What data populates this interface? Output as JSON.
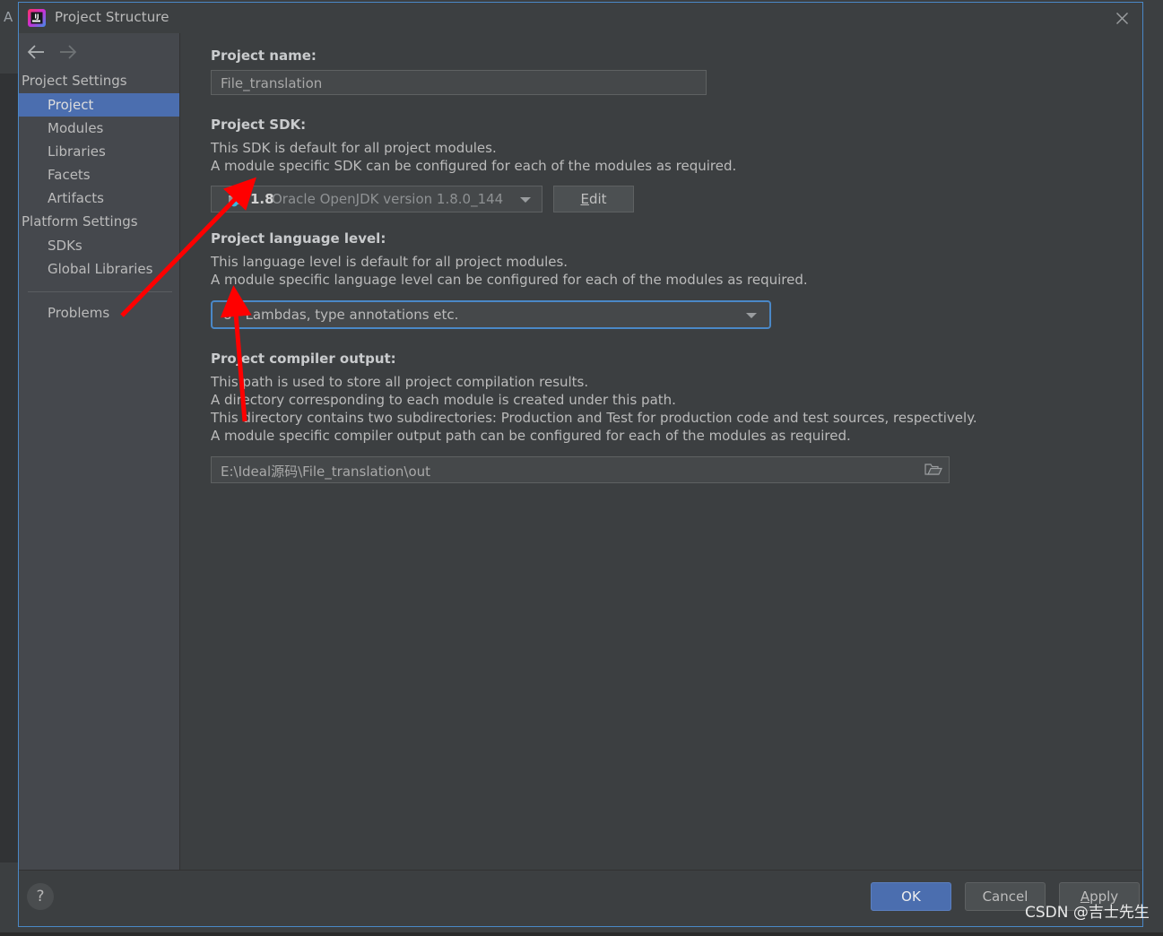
{
  "backdrop": {
    "letter": "A"
  },
  "window": {
    "title": "Project Structure",
    "icon": "intellij-idea-icon",
    "close_label": "close-icon"
  },
  "sidebar": {
    "nav": {
      "back": "back-arrow-icon",
      "forward": "forward-arrow-icon"
    },
    "groups": [
      {
        "title": "Project Settings",
        "items": [
          {
            "label": "Project",
            "selected": true
          },
          {
            "label": "Modules",
            "selected": false
          },
          {
            "label": "Libraries",
            "selected": false
          },
          {
            "label": "Facets",
            "selected": false
          },
          {
            "label": "Artifacts",
            "selected": false
          }
        ]
      },
      {
        "title": "Platform Settings",
        "items": [
          {
            "label": "SDKs",
            "selected": false
          },
          {
            "label": "Global Libraries",
            "selected": false
          }
        ]
      }
    ],
    "extra_items": [
      {
        "label": "Problems",
        "selected": false
      }
    ]
  },
  "main": {
    "project_name": {
      "label": "Project name:",
      "value": "File_translation",
      "placeholder": ""
    },
    "project_sdk": {
      "label": "Project SDK:",
      "desc_lines": [
        "This SDK is default for all project modules.",
        "A module specific SDK can be configured for each of the modules as required."
      ],
      "selected_version": "1.8",
      "selected_desc": "Oracle OpenJDK version 1.8.0_144",
      "icon": "jdk-folder-icon",
      "edit_button": {
        "mnemonic": "E",
        "rest": "dit"
      }
    },
    "language_level": {
      "label": "Project language level:",
      "desc_lines": [
        "This language level is default for all project modules.",
        "A module specific language level can be configured for each of the modules as required."
      ],
      "selected": "8 - Lambdas, type annotations etc.",
      "focus_color": "#4a88c7"
    },
    "compiler_output": {
      "label": "Project compiler output:",
      "desc_lines": [
        "This path is used to store all project compilation results.",
        "A directory corresponding to each module is created under this path.",
        "This directory contains two subdirectories: Production and Test for production code and test sources, respectively.",
        "A module specific compiler output path can be configured for each of the modules as required."
      ],
      "value": "E:\\Ideal源码\\File_translation\\out",
      "browse_icon": "folder-browse-icon"
    }
  },
  "footer": {
    "help": "?",
    "ok": "OK",
    "cancel": "Cancel",
    "apply_mnemonic": "A",
    "apply_rest": "pply"
  },
  "annotations": {
    "arrow_color": "#ff0000",
    "watermark": "CSDN @吉士先生"
  },
  "colors": {
    "dialog_border": "#4a88c7",
    "selection": "#4b6eaf",
    "sidebar_bg": "#45484d",
    "main_bg": "#3c3f41",
    "ok_button": "#4b6eaf"
  }
}
